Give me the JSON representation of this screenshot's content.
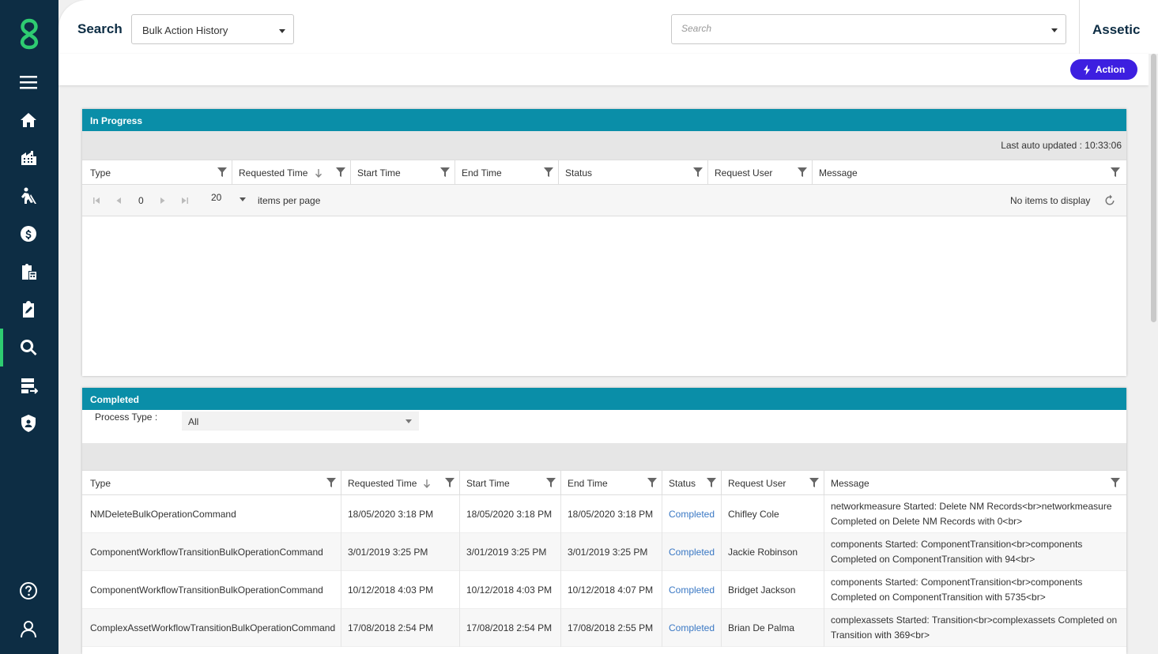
{
  "header": {
    "title": "Search",
    "view_select": "Bulk Action History",
    "search_placeholder": "Search",
    "brand": "Assetic"
  },
  "toolbar": {
    "action_label": "Action"
  },
  "sidebar": {
    "items": [
      "menu-icon",
      "home-icon",
      "buildings-icon",
      "worker-icon",
      "finance-icon",
      "clipboard-calculator-icon",
      "edit-clipboard-icon",
      "search-icon",
      "database-transfer-icon",
      "shield-user-icon",
      "help-icon",
      "user-icon"
    ],
    "active": "search-icon",
    "accent": "#2ecc71",
    "background": "#0d2d44"
  },
  "in_progress": {
    "title": "In Progress",
    "last_updated": "Last auto updated : 10:33:06",
    "columns": [
      "Type",
      "Requested Time",
      "Start Time",
      "End Time",
      "Status",
      "Request User",
      "Message"
    ],
    "pager": {
      "page": "0",
      "page_size": "20",
      "per_page_label": "items per page",
      "empty_text": "No items to display"
    }
  },
  "completed": {
    "title": "Completed",
    "process_type_label": "Process Type :",
    "process_type_value": "All",
    "columns": [
      "Type",
      "Requested Time",
      "Start Time",
      "End Time",
      "Status",
      "Request User",
      "Message"
    ],
    "rows": [
      {
        "type": "NMDeleteBulkOperationCommand",
        "requested": "18/05/2020 3:18 PM",
        "start": "18/05/2020 3:18 PM",
        "end": "18/05/2020 3:18 PM",
        "status": "Completed",
        "user": "Chifley Cole",
        "message": "networkmeasure Started: Delete NM Records<br>networkmeasure Completed on Delete NM Records with 0<br>"
      },
      {
        "type": "ComponentWorkflowTransitionBulkOperationCommand",
        "requested": "3/01/2019 3:25 PM",
        "start": "3/01/2019 3:25 PM",
        "end": "3/01/2019 3:25 PM",
        "status": "Completed",
        "user": "Jackie Robinson",
        "message": "components Started: ComponentTransition<br>components Completed on ComponentTransition with 94<br>"
      },
      {
        "type": "ComponentWorkflowTransitionBulkOperationCommand",
        "requested": "10/12/2018 4:03 PM",
        "start": "10/12/2018 4:03 PM",
        "end": "10/12/2018 4:07 PM",
        "status": "Completed",
        "user": "Bridget Jackson",
        "message": "components Started: ComponentTransition<br>components Completed on ComponentTransition with 5735<br>"
      },
      {
        "type": "ComplexAssetWorkflowTransitionBulkOperationCommand",
        "requested": "17/08/2018 2:54 PM",
        "start": "17/08/2018 2:54 PM",
        "end": "17/08/2018 2:55 PM",
        "status": "Completed",
        "user": "Brian De Palma",
        "message": "complexassets Started: Transition<br>complexassets Completed on Transition with 369<br>"
      }
    ]
  },
  "colors": {
    "panel_header": "#0a8ea8",
    "action_button": "#3d1fe0",
    "status_link": "#3a78c4"
  }
}
